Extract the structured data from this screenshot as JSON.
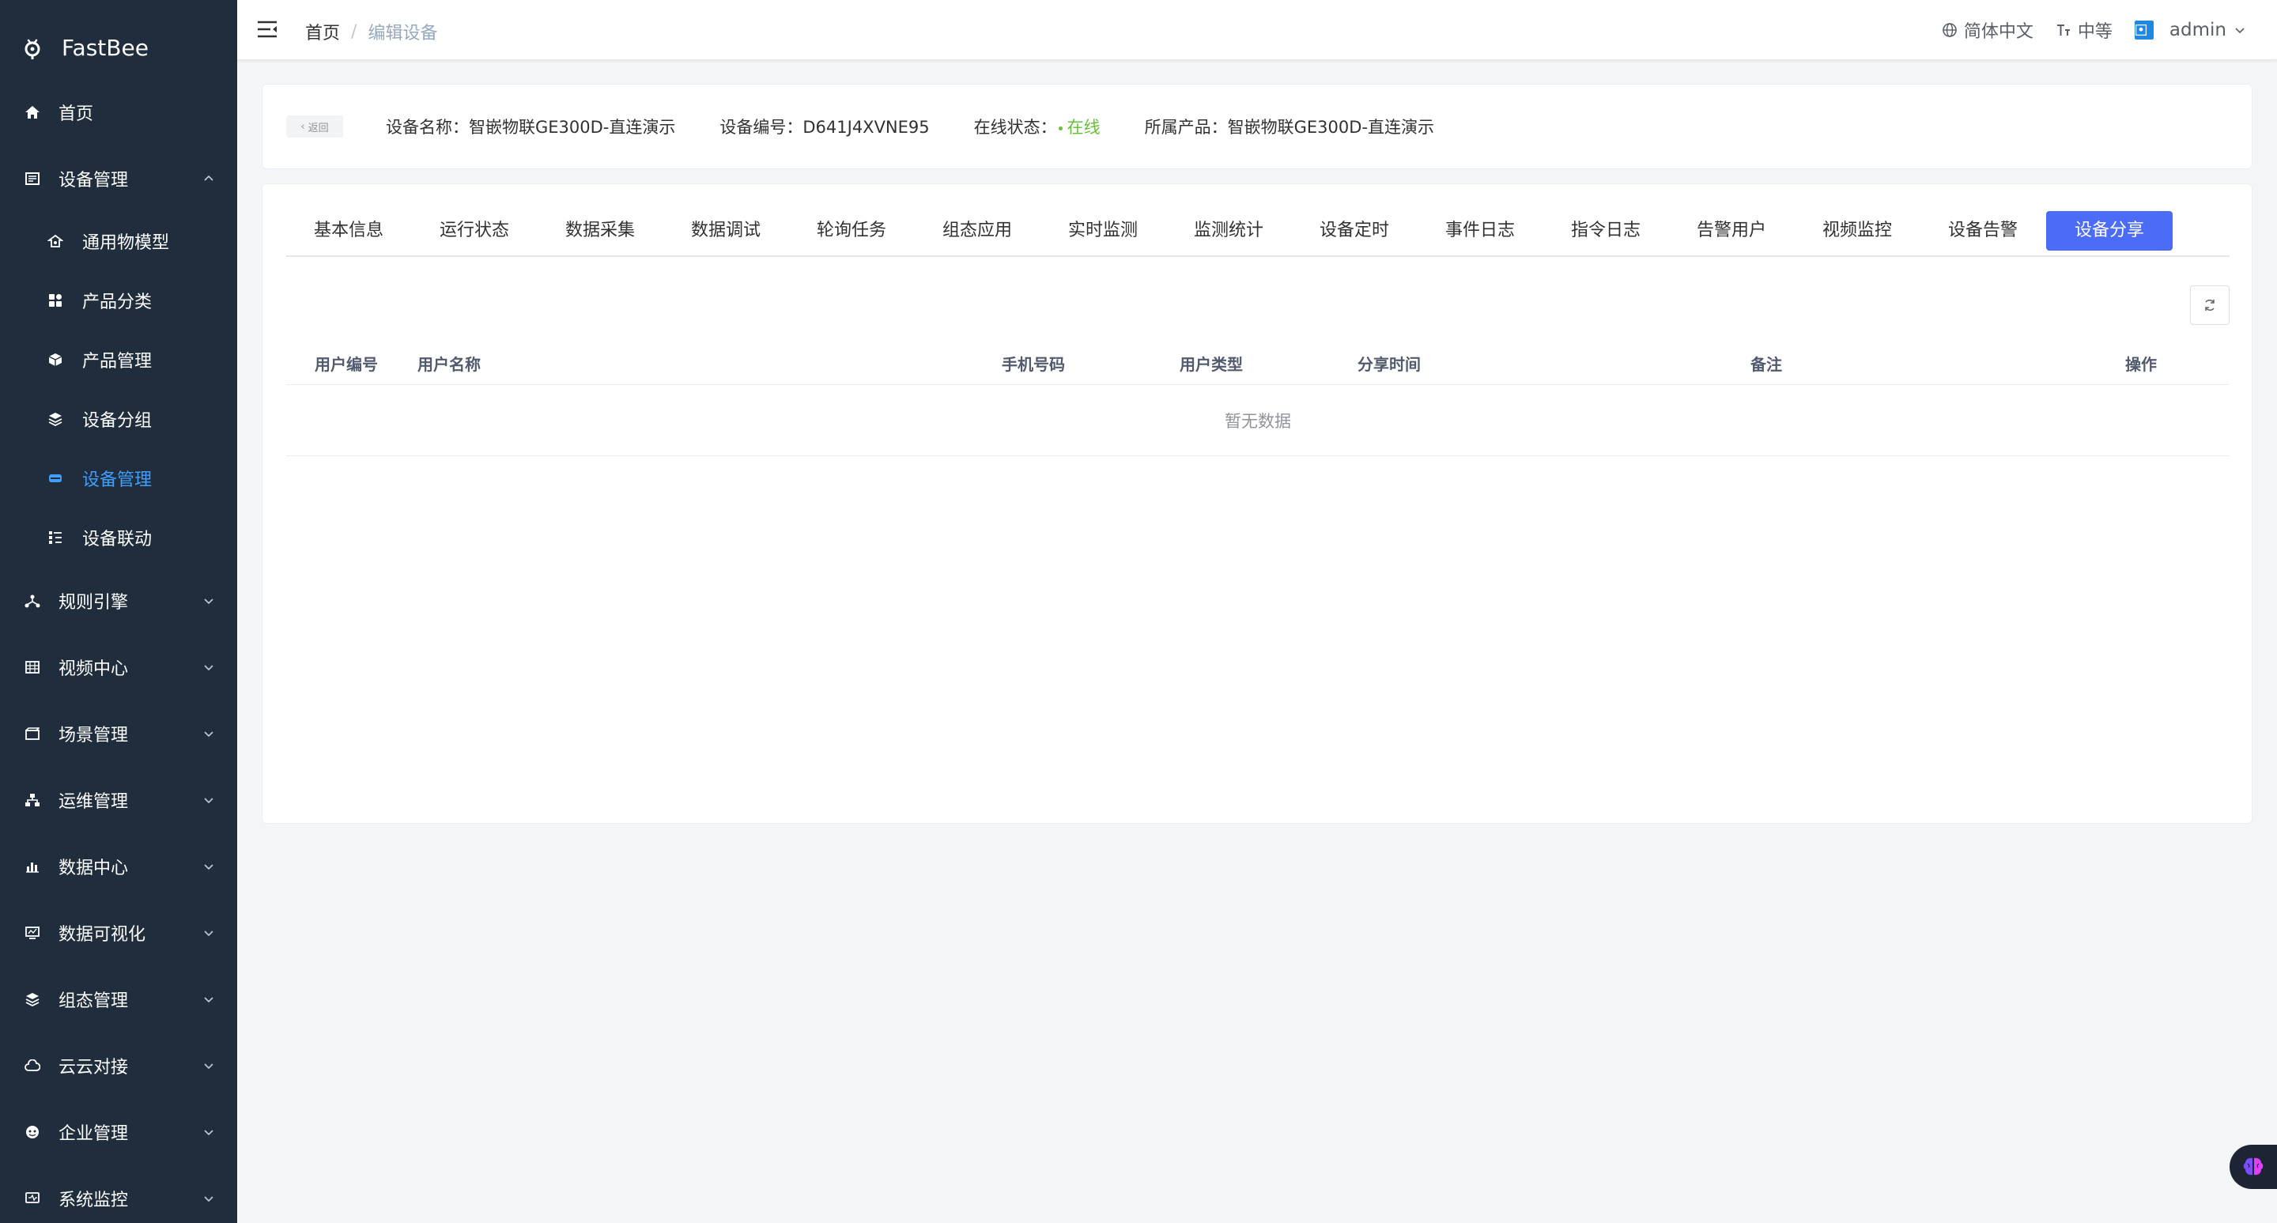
{
  "app": {
    "name": "FastBee"
  },
  "sidebar": {
    "items": [
      {
        "label": "首页",
        "icon": "home-icon"
      },
      {
        "label": "设备管理",
        "icon": "device-icon",
        "expanded": true,
        "children": [
          {
            "label": "通用物模型",
            "icon": "model-icon"
          },
          {
            "label": "产品分类",
            "icon": "category-icon"
          },
          {
            "label": "产品管理",
            "icon": "product-icon"
          },
          {
            "label": "设备分组",
            "icon": "group-icon"
          },
          {
            "label": "设备管理",
            "icon": "device-manage-icon",
            "active": true
          },
          {
            "label": "设备联动",
            "icon": "linkage-icon"
          }
        ]
      },
      {
        "label": "规则引擎",
        "icon": "rule-icon"
      },
      {
        "label": "视频中心",
        "icon": "video-icon"
      },
      {
        "label": "场景管理",
        "icon": "scene-icon"
      },
      {
        "label": "运维管理",
        "icon": "ops-icon"
      },
      {
        "label": "数据中心",
        "icon": "data-icon"
      },
      {
        "label": "数据可视化",
        "icon": "visual-icon"
      },
      {
        "label": "组态管理",
        "icon": "config-icon"
      },
      {
        "label": "云云对接",
        "icon": "cloud-icon"
      },
      {
        "label": "企业管理",
        "icon": "enterprise-icon"
      },
      {
        "label": "系统监控",
        "icon": "monitor-icon"
      }
    ]
  },
  "topbar": {
    "breadcrumb": {
      "home": "首页",
      "sep": "/",
      "current": "编辑设备"
    },
    "language": "简体中文",
    "size": "中等",
    "user": "admin"
  },
  "device": {
    "back": "返回",
    "name_label": "设备名称：",
    "name": "智嵌物联GE300D-直连演示",
    "serial_label": "设备编号：",
    "serial": "D641J4XVNE95",
    "status_label": "在线状态：",
    "status": "在线",
    "product_label": "所属产品：",
    "product": "智嵌物联GE300D-直连演示"
  },
  "tabs": [
    "基本信息",
    "运行状态",
    "数据采集",
    "数据调试",
    "轮询任务",
    "组态应用",
    "实时监测",
    "监测统计",
    "设备定时",
    "事件日志",
    "指令日志",
    "告警用户",
    "视频监控",
    "设备告警",
    "设备分享"
  ],
  "active_tab": "设备分享",
  "table": {
    "columns": [
      "用户编号",
      "用户名称",
      "手机号码",
      "用户类型",
      "分享时间",
      "备注",
      "操作"
    ],
    "rows": [],
    "empty_text": "暂无数据"
  },
  "colors": {
    "sidebar_bg": "#1f2d3d",
    "accent": "#4a6cf7",
    "active_menu": "#409eff",
    "online": "#67c23a"
  }
}
